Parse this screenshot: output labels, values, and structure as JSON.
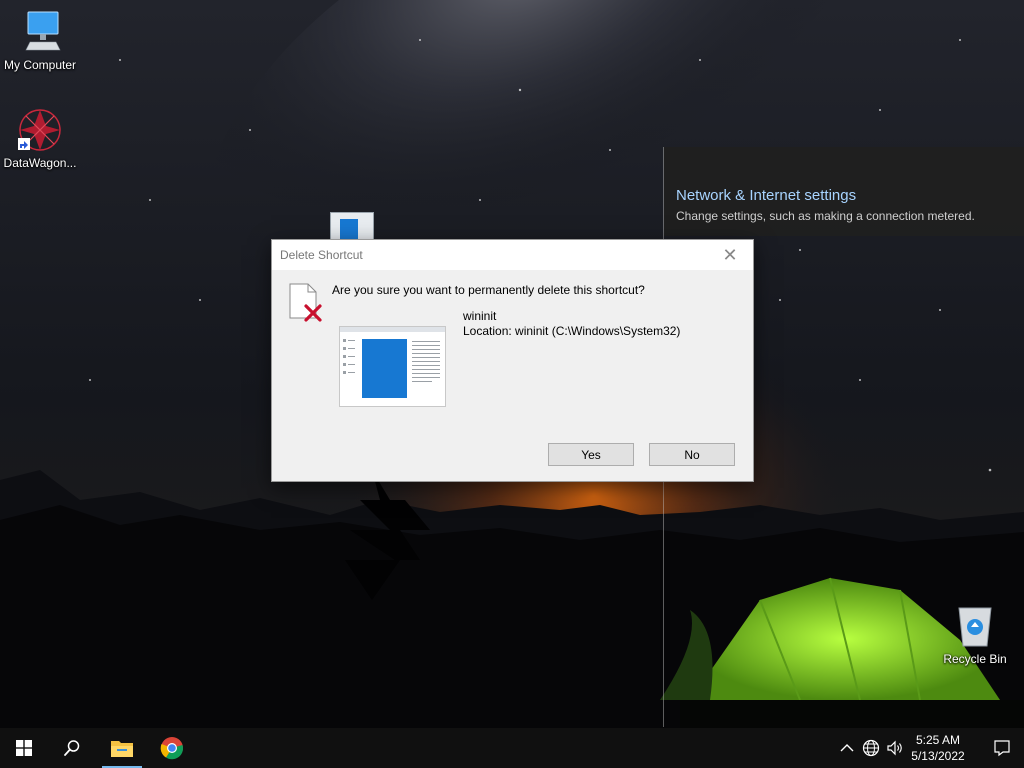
{
  "desktop": {
    "icons": [
      {
        "label": "My Computer"
      },
      {
        "label": "DataWagon..."
      },
      {
        "label": "Recycle Bin"
      }
    ]
  },
  "flyout": {
    "title": "Network & Internet settings",
    "subtitle": "Change settings, such as making a connection metered."
  },
  "dialog": {
    "title": "Delete Shortcut",
    "close_glyph": "✕",
    "question": "Are you sure you want to permanently delete this shortcut?",
    "file_name": "wininit",
    "location": "Location: wininit (C:\\Windows\\System32)",
    "yes_label": "Yes",
    "no_label": "No"
  },
  "taskbar": {
    "start_icon": "windows-start-icon",
    "search_icon": "search-icon",
    "pinned": [
      "file-explorer-icon",
      "chrome-icon"
    ],
    "tray": [
      "chevron-up-icon",
      "network-globe-icon",
      "volume-icon"
    ],
    "time": "5:25 AM",
    "date": "5/13/2022",
    "notification_icon": "action-center-icon"
  },
  "colors": {
    "taskbar_bg": "#101010",
    "dialog_bg": "#f0f0f0",
    "flyout_link": "#a8d4ff",
    "accent": "#0078d7",
    "tent_green": "#8ee02a"
  }
}
